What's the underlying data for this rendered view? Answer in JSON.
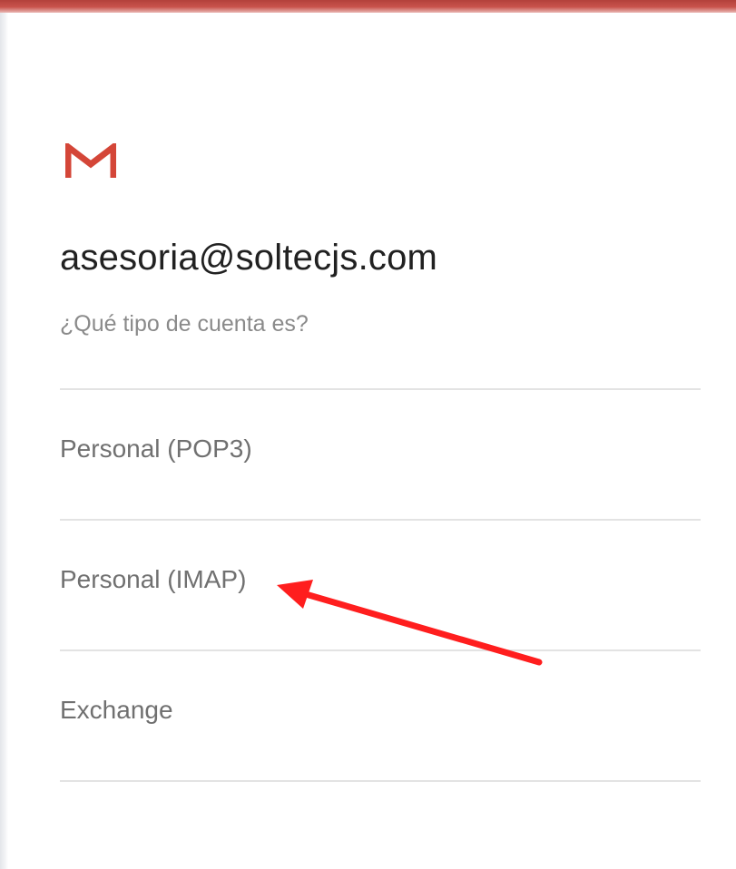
{
  "header": {
    "accent_color": "#c5463f",
    "logo_icon": "gmail-logo-icon"
  },
  "account": {
    "email": "asesoria@soltecjs.com",
    "question": "¿Qué tipo de cuenta es?"
  },
  "options": [
    {
      "label": "Personal (POP3)"
    },
    {
      "label": "Personal (IMAP)"
    },
    {
      "label": "Exchange"
    }
  ],
  "annotation": {
    "arrow_color": "#ff1e1e",
    "icon": "red-arrow-icon",
    "target": "Personal (IMAP)"
  }
}
